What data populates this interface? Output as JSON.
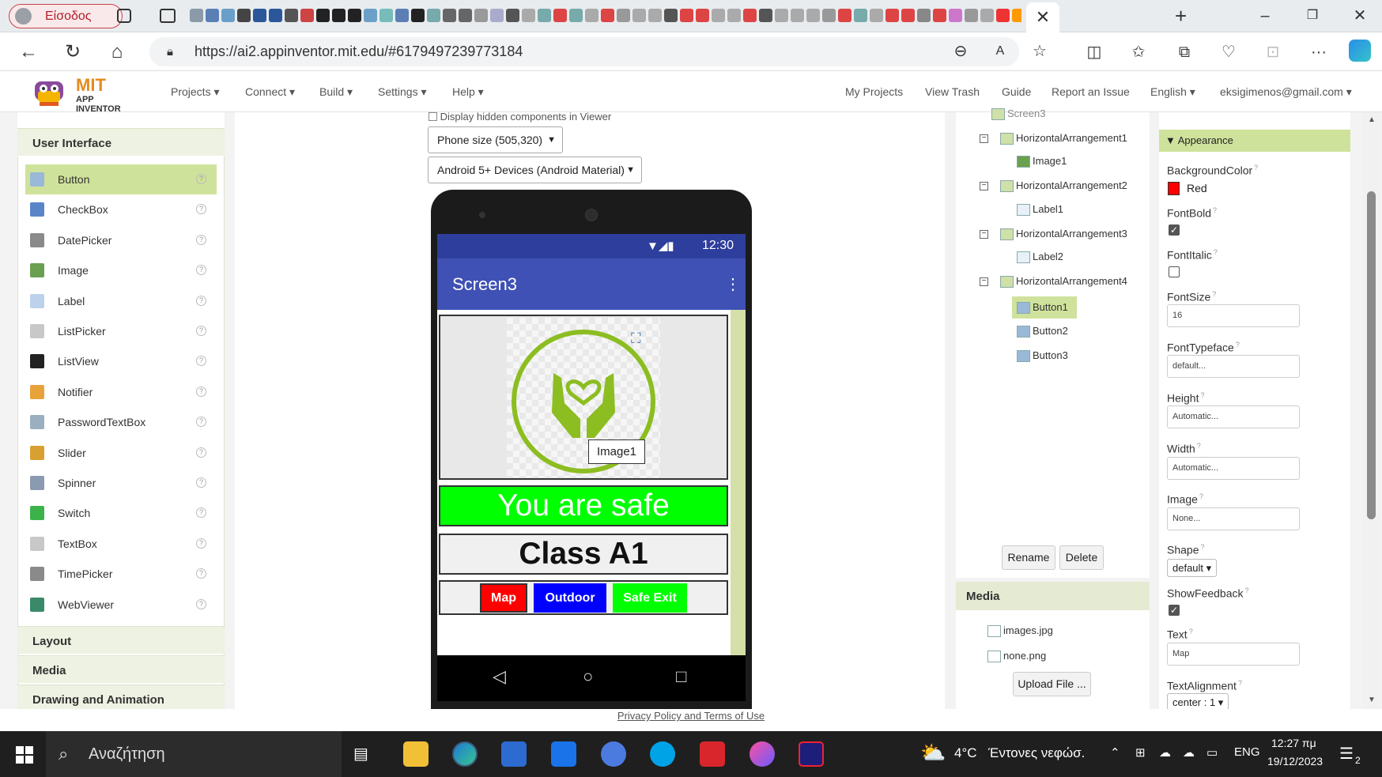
{
  "browser": {
    "profile_label": "Είσοδος",
    "url": "https://ai2.appinventor.mit.edu/#6179497239773184",
    "tab_icon_colors": [
      "#8a9aa8",
      "#5b7fb5",
      "#6aa0c8",
      "#444",
      "#2b579a",
      "#2b579a",
      "#555",
      "#c44",
      "#222",
      "#222",
      "#222",
      "#6aa0c8",
      "#7bb",
      "#5b7fb5",
      "#222",
      "#7aa",
      "#666",
      "#666",
      "#999",
      "#aac",
      "#555",
      "#aaa",
      "#7aa",
      "#d44",
      "#7aa",
      "#aaa",
      "#d44",
      "#999",
      "#aaa",
      "#aaa",
      "#555",
      "#d44",
      "#d44",
      "#aaa",
      "#aaa",
      "#d44",
      "#555",
      "#aaa",
      "#aaa",
      "#aaa",
      "#999",
      "#d44",
      "#7aa",
      "#aaa",
      "#d44",
      "#d44",
      "#888",
      "#d44",
      "#c7c",
      "#999",
      "#aaa",
      "#e33",
      "#f90",
      "#c33",
      "#e44",
      "#4a4",
      "#8c4"
    ]
  },
  "ai": {
    "logo_mit": "MIT",
    "logo_sub": "APP INVENTOR",
    "menus": [
      "Projects ▾",
      "Connect ▾",
      "Build ▾",
      "Settings ▾",
      "Help ▾"
    ],
    "right_links": [
      "My Projects",
      "View Trash",
      "Guide",
      "Report an Issue",
      "English ▾",
      "eksigimenos@gmail.com ▾"
    ]
  },
  "palette": {
    "heading": "User Interface",
    "items": [
      {
        "label": "Button",
        "color": "#9ab8d8"
      },
      {
        "label": "CheckBox",
        "color": "#5b85c9"
      },
      {
        "label": "DatePicker",
        "color": "#8a8a8a"
      },
      {
        "label": "Image",
        "color": "#6aa050"
      },
      {
        "label": "Label",
        "color": "#bcd2ea"
      },
      {
        "label": "ListPicker",
        "color": "#c8c8c8"
      },
      {
        "label": "ListView",
        "color": "#222222"
      },
      {
        "label": "Notifier",
        "color": "#e7a33a"
      },
      {
        "label": "PasswordTextBox",
        "color": "#9ab0c0"
      },
      {
        "label": "Slider",
        "color": "#d8a030"
      },
      {
        "label": "Spinner",
        "color": "#8a9ab0"
      },
      {
        "label": "Switch",
        "color": "#3cb34a"
      },
      {
        "label": "TextBox",
        "color": "#c8c8c8"
      },
      {
        "label": "TimePicker",
        "color": "#8a8a8a"
      },
      {
        "label": "WebViewer",
        "color": "#3a8a6a"
      }
    ],
    "sections": [
      "Layout",
      "Media",
      "Drawing and Animation"
    ]
  },
  "viewer": {
    "hidden_components_label": "Display hidden components in Viewer",
    "phone_size": "Phone size (505,320)",
    "theme": "Android 5+ Devices (Android Material)",
    "status_time": "12:30",
    "screen_title": "Screen3",
    "image_tooltip": "Image1",
    "safe_label": "You are safe",
    "class_label": "Class A1",
    "buttons": [
      {
        "label": "Map",
        "color": "#ff0000"
      },
      {
        "label": "Outdoor",
        "color": "#0000ff"
      },
      {
        "label": "Safe Exit",
        "color": "#00ff00"
      }
    ]
  },
  "tree": {
    "root": "Screen3",
    "nodes": [
      "HorizontalArrangement1",
      "Image1",
      "HorizontalArrangement2",
      "Label1",
      "HorizontalArrangement3",
      "Label2",
      "HorizontalArrangement4",
      "Button1",
      "Button2",
      "Button3"
    ],
    "rename": "Rename",
    "delete": "Delete"
  },
  "media": {
    "heading": "Media",
    "files": [
      "images.jpg",
      "none.png"
    ],
    "upload": "Upload File ..."
  },
  "props": {
    "heading": "Appearance",
    "background_label": "BackgroundColor",
    "background_value": "Red",
    "background_swatch": "#ff0000",
    "fontbold_label": "FontBold",
    "fontbold_checked": true,
    "fontitalic_label": "FontItalic",
    "fontitalic_checked": false,
    "fontsize_label": "FontSize",
    "fontsize_value": "16",
    "fonttypeface_label": "FontTypeface",
    "fonttypeface_value": "default...",
    "height_label": "Height",
    "height_value": "Automatic...",
    "width_label": "Width",
    "width_value": "Automatic...",
    "image_label": "Image",
    "image_value": "None...",
    "shape_label": "Shape",
    "shape_value": "default ▾",
    "showfeedback_label": "ShowFeedback",
    "showfeedback_checked": true,
    "text_label": "Text",
    "text_value": "Map",
    "textalign_label": "TextAlignment",
    "textalign_value": "center : 1 ▾"
  },
  "footer": {
    "privacy": "Privacy Policy and Terms of Use"
  },
  "taskbar": {
    "search": "Αναζήτηση",
    "weather_temp": "4°C",
    "weather_text": "Έντονες νεφώσ.",
    "language": "ENG",
    "time": "12:27 πμ",
    "date": "19/12/2023",
    "notifications": "2"
  }
}
